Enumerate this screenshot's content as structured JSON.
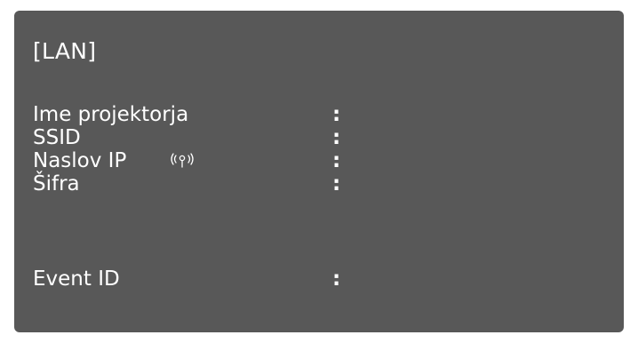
{
  "screen": {
    "title": "[LAN]",
    "rows": [
      {
        "label": "Ime projektorja",
        "separator": ":"
      },
      {
        "label": "SSID",
        "separator": ":"
      },
      {
        "label": "Naslov IP",
        "separator": ":",
        "icon": "wireless-signal-icon"
      },
      {
        "label": "Šifra",
        "separator": ":"
      },
      {
        "label": "Event ID",
        "separator": ":"
      }
    ]
  },
  "colors": {
    "panel_background": "#585858",
    "text": "#ffffff"
  }
}
